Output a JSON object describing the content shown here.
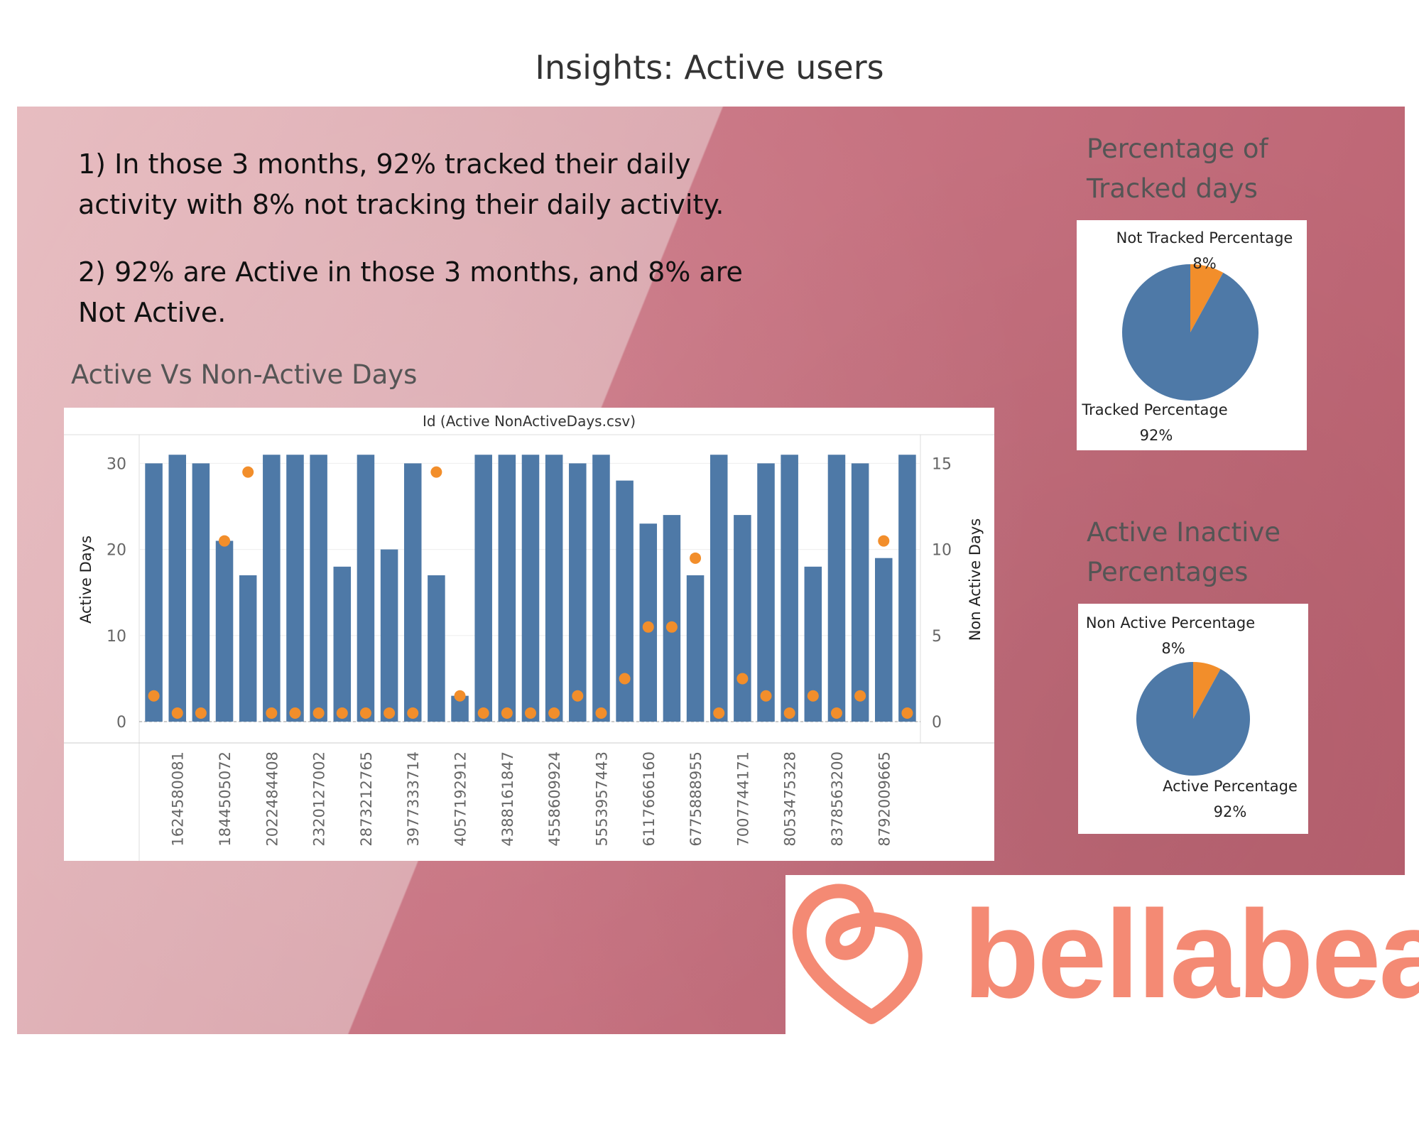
{
  "page": {
    "title": "Insights: Active users"
  },
  "insights": {
    "line1": "1) In those 3 months, 92% tracked their daily activity with 8% not tracking their daily activity.",
    "line2": "2) 92% are Active in those 3 months, and 8% are Not Active."
  },
  "sections": {
    "bar_title": "Active Vs Non-Active Days",
    "tracked_title": "Percentage of Tracked days",
    "active_title": "Active Inactive Percentages"
  },
  "logo": {
    "text": "bellabeat"
  },
  "colors": {
    "bar": "#4e79a7",
    "dot": "#f28e2b",
    "logo": "#f48a74"
  },
  "chart_data": [
    {
      "type": "bar",
      "title": "Id (Active NonActiveDays.csv)",
      "ylabel": "Active Days",
      "y2label": "Non Active Days",
      "ylim": [
        0,
        33
      ],
      "y2lim": [
        0,
        16.5
      ],
      "yticks": [
        0,
        10,
        20,
        30
      ],
      "y2ticks": [
        0,
        5,
        10,
        15
      ],
      "xtick_labels": [
        "1624580081",
        "1844505072",
        "2022484408",
        "2320127002",
        "2873212765",
        "3977333714",
        "4057192912",
        "4388161847",
        "4558609924",
        "5553957443",
        "6117666160",
        "6775888955",
        "7007744171",
        "8053475328",
        "8378563200",
        "8792009665"
      ],
      "series": [
        {
          "name": "Active Days",
          "kind": "bar",
          "values": [
            30,
            31,
            30,
            21,
            17,
            31,
            31,
            31,
            18,
            31,
            20,
            30,
            17,
            3,
            31,
            31,
            31,
            31,
            30,
            31,
            28,
            23,
            24,
            17,
            31,
            24,
            30,
            31,
            18,
            31,
            30,
            19,
            31
          ]
        },
        {
          "name": "Non Active Days",
          "kind": "dot",
          "axis": "y2",
          "values": [
            1,
            0,
            0,
            10,
            14,
            0,
            0,
            0,
            0,
            0,
            0,
            0,
            14,
            1,
            0,
            0,
            0,
            0,
            1,
            0,
            2,
            5,
            5,
            9,
            0,
            2,
            1,
            0,
            1,
            0,
            1,
            10,
            0
          ]
        }
      ],
      "grid": true,
      "legend": "none"
    },
    {
      "type": "pie",
      "slices": [
        {
          "label": "Tracked Percentage",
          "value": 92,
          "value_label": "92%",
          "color": "#4e79a7"
        },
        {
          "label": "Not Tracked Percentage",
          "value": 8,
          "value_label": "8%",
          "color": "#f28e2b"
        }
      ]
    },
    {
      "type": "pie",
      "slices": [
        {
          "label": "Active Percentage",
          "value": 92,
          "value_label": "92%",
          "color": "#4e79a7"
        },
        {
          "label": "Non Active Percentage",
          "value": 8,
          "value_label": "8%",
          "color": "#f28e2b"
        }
      ]
    }
  ]
}
